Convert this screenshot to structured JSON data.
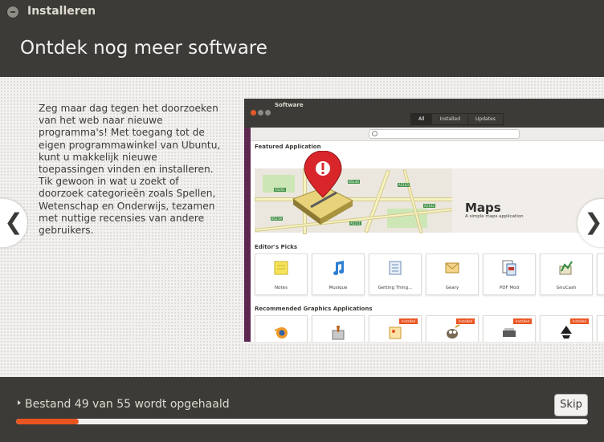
{
  "window": {
    "title": "Installeren"
  },
  "header": {
    "title": "Ontdek nog meer software"
  },
  "slide": {
    "text": "Zeg maar dag tegen het doorzoeken van het web naar nieuwe programma's! Met toegang tot de eigen programmawinkel van Ubuntu, kunt u makkelijk nieuwe toepassingen vinden en installeren. Tik gewoon in wat u zoekt of doorzoek categorieën zoals Spellen, Wetenschap en Onderwijs, tezamen met nuttige recensies van andere gebruikers.",
    "prev_icon": "chevron-left-icon",
    "next_icon": "chevron-right-icon",
    "prev_glyph": "❮",
    "next_glyph": "❯"
  },
  "software_center": {
    "window_title": "Software",
    "tabs": [
      "All",
      "Installed",
      "Updates"
    ],
    "featured_heading": "Featured Application",
    "featured": {
      "name": "Maps",
      "subtitle": "A simple maps application"
    },
    "map_road_labels": [
      "A5201",
      "B5144",
      "A5103",
      "B5219",
      "A5211",
      "A1102"
    ],
    "editors_picks_heading": "Editor's Picks",
    "editors_picks": [
      {
        "label": "Notes",
        "icon": "notes-icon"
      },
      {
        "label": "Musique",
        "icon": "music-note-icon"
      },
      {
        "label": "Getting Thing...",
        "icon": "checklist-icon"
      },
      {
        "label": "Geary",
        "icon": "mail-icon"
      },
      {
        "label": "PDF Mod",
        "icon": "pdf-icon"
      },
      {
        "label": "GnuCash",
        "icon": "finance-icon"
      }
    ],
    "graphics_heading": "Recommended Graphics Applications",
    "graphics_apps": [
      {
        "icon": "blender-icon",
        "installed": false
      },
      {
        "icon": "paint-icon",
        "installed": false
      },
      {
        "icon": "image-viewer-icon",
        "installed": true
      },
      {
        "icon": "gimp-icon",
        "installed": true
      },
      {
        "icon": "scanner-icon",
        "installed": true
      },
      {
        "icon": "inkscape-icon",
        "installed": true
      }
    ],
    "installed_badge": "Installed"
  },
  "footer": {
    "status": "Bestand 49 van 55 wordt opgehaald",
    "skip_label": "Skip",
    "progress_fraction": 0.11
  },
  "colors": {
    "accent": "#e95420",
    "background": "#3c3b37",
    "aubergine": "#5e2750"
  }
}
